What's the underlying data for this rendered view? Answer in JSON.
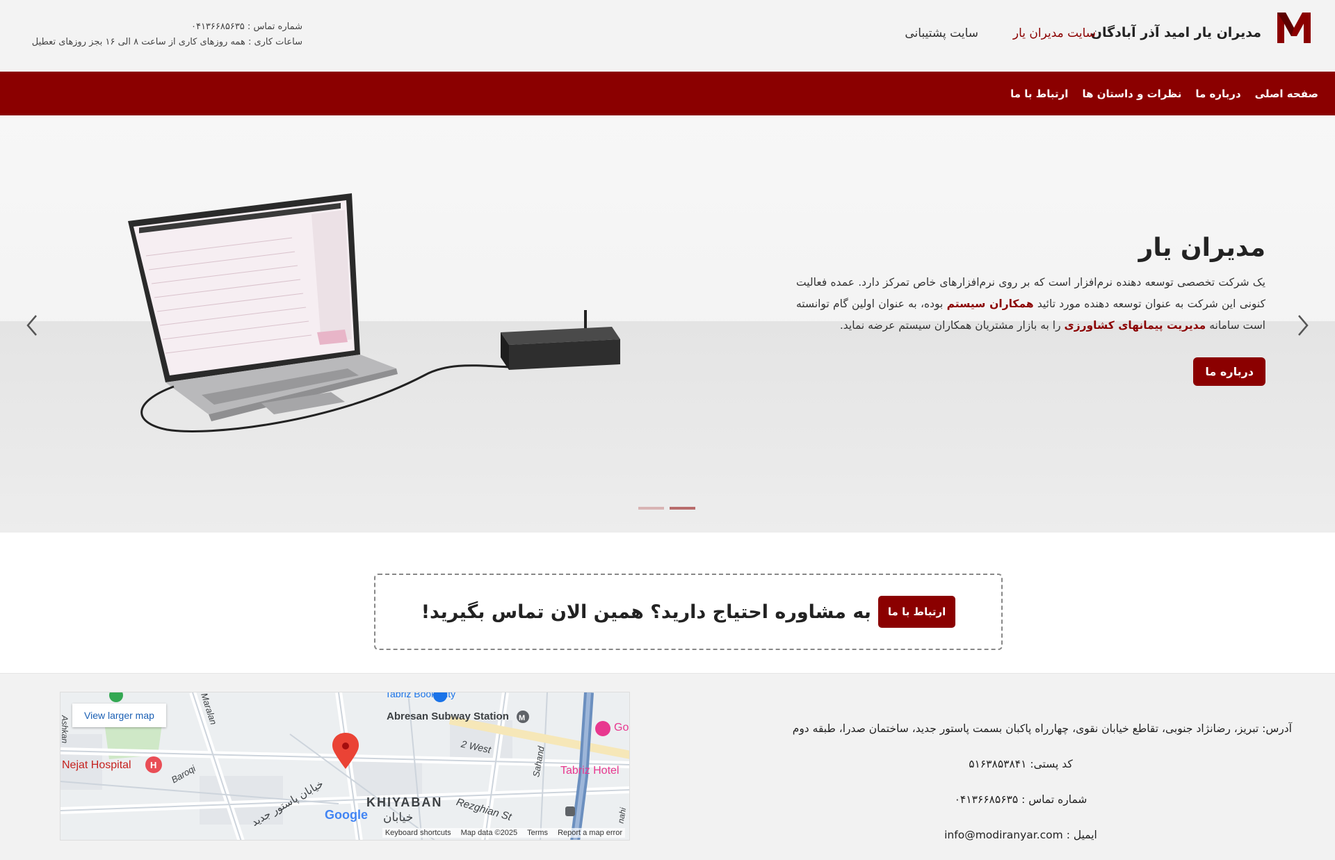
{
  "header": {
    "brand_name": "مدیران یار امید آذر آبادگان",
    "link_main_site": "سایت مدیران یار",
    "link_support_site": "سایت پشتیبانی",
    "contact_phone": "شماره تماس : ۰۴۱۳۶۶۸۵۶۳۵",
    "working_hours": "ساعات کاری : همه روزهای کاری از ساعت ۸ الی ۱۶ بجز روزهای تعطیل",
    "brand_color": "#8b0000"
  },
  "nav": {
    "items": [
      "صفحه اصلی",
      "درباره ما",
      "نظرات و داستان ها",
      "ارتباط با ما"
    ]
  },
  "hero": {
    "title": "مدیران یار",
    "body_1": "یک شرکت تخصصی توسعه دهنده نرم‌افزار است که بر روی نرم‌افزارهای خاص تمرکز دارد. عمده فعالیت کنونی این شرکت به عنوان توسعه دهنده مورد تائید ",
    "highlight_1": "همکاران سیستم",
    "body_2": " بوده، به عنوان اولین گام توانسته است سامانه ",
    "highlight_2": "مدیریت پیمانهای کشاورزی",
    "body_3": " را به بازار مشتریان همکاران سیستم عرضه نماید.",
    "button_label": "درباره ما",
    "slides_count": 2,
    "active_slide": 2,
    "icons": {
      "prev": "chevron-left-icon",
      "next": "chevron-right-icon"
    }
  },
  "cta": {
    "text": "به مشاوره احتیاج دارید؟ همین الان تماس بگیرید!",
    "button_label": "ارتباط با ما"
  },
  "footer": {
    "address": "آدرس: تبریز، رضانژاد جنوبی، تقاطع خیابان نقوی، چهارراه پاکبان بسمت پاستور جدید، ساختمان صدرا، طبقه دوم",
    "postal_code": "کد پستی: ۵۱۶۳۸۵۳۸۴۱",
    "phone": "شماره تماس : ۰۴۱۳۶۶۸۵۶۳۵",
    "email": "ایمیل : info@modiranyar.com"
  },
  "map": {
    "view_larger": "View larger map",
    "labels": {
      "book_city": "Tabriz Book City",
      "subway": "Abresan Subway Station",
      "hospital": "Nejat Hospital",
      "baroqi": "Baroqi",
      "maralan": "Maralan",
      "ashkan": "Ashkan",
      "west": "2 West",
      "sahand": "Sahand",
      "hotel": "Tabriz Hotel",
      "gos": "Gos",
      "khiyaban": "KHIYABAN",
      "khiyaban_fa": "خیابان",
      "rezghian": "Rezghian St",
      "pastor": "خیابان پاستور جدید",
      "mahi": "nahi",
      "google": "Google"
    },
    "footer": {
      "shortcuts": "Keyboard shortcuts",
      "data": "Map data ©2025",
      "terms": "Terms",
      "report": "Report a map error"
    }
  }
}
